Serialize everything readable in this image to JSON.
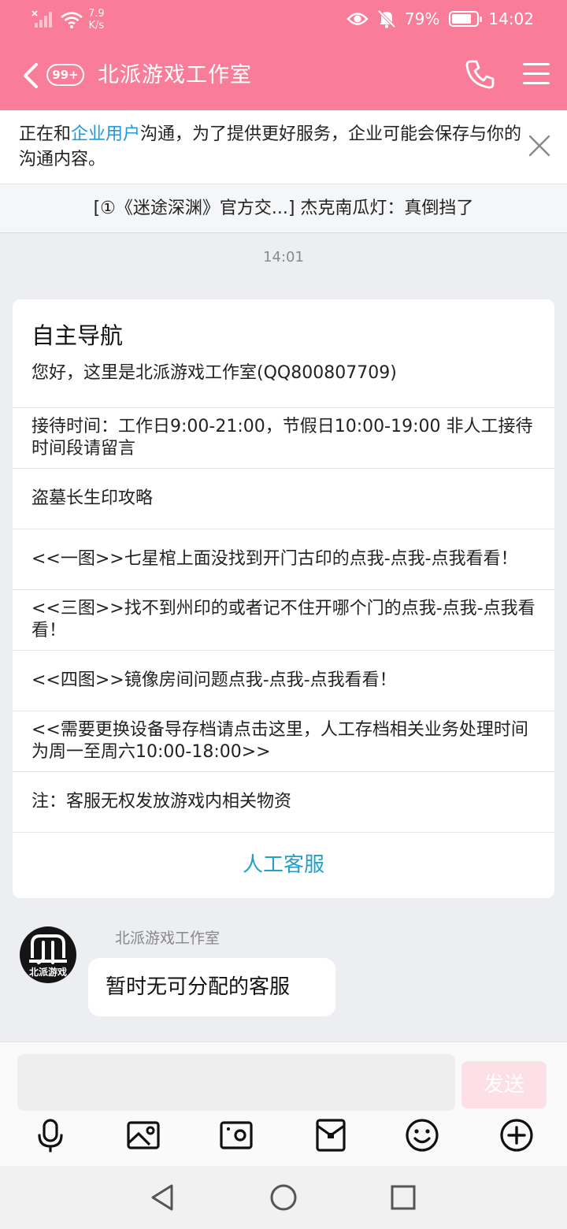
{
  "status_bar": {
    "net_speed_value": "7.9",
    "net_speed_unit": "K/s",
    "battery": "79%",
    "battery_level": 0.79,
    "time": "14:02",
    "icons": [
      "signal-icon",
      "wifi-icon",
      "eye-icon",
      "mute-bell-icon",
      "battery-icon"
    ]
  },
  "header": {
    "badge": "99+",
    "title": "北派游戏工作室",
    "icons": [
      "back-icon",
      "phone-icon",
      "menu-icon"
    ]
  },
  "notice": {
    "prefix": "正在和",
    "highlight": "企业用户",
    "suffix": "沟通，为了提供更好服务，企业可能会保存与你的沟通内容。",
    "highlight_color": "#1b9ae0"
  },
  "pinned_message": "[①《迷途深渊》官方交...] 杰克南瓜灯：真倒挡了",
  "messages": {
    "timestamp": "14:01",
    "nav_card": {
      "title": "自主导航",
      "greeting": "您好，这里是北派游戏工作室(QQ800807709)",
      "items": [
        "接待时间：工作日9:00-21:00，节假日10:00-19:00 非人工接待时间段请留言",
        "盗墓长生印攻略",
        "<<一图>>七星棺上面没找到开门古印的点我-点我-点我看看！",
        "<<三图>>找不到州印的或者记不住开哪个门的点我-点我-点我看看！",
        "<<四图>>镜像房间问题点我-点我-点我看看！",
        "<<需要更换设备导存档请点击这里，人工存档相关业务处理时间为周一至周六10:00-18:00>>",
        "注：客服无权发放游戏内相关物资"
      ],
      "human_service": "人工客服"
    },
    "sender_name": "北派游戏工作室",
    "avatar_text": "北派游戏",
    "bubble_text": "暂时无可分配的客服"
  },
  "input": {
    "placeholder": "",
    "send_label": "发送",
    "tools": [
      "microphone-icon",
      "image-icon",
      "camera-icon",
      "red-packet-icon",
      "emoji-icon",
      "plus-icon"
    ]
  },
  "system_nav": [
    "back-triangle-icon",
    "home-circle-icon",
    "recents-square-icon"
  ],
  "colors": {
    "header_bg": "#f97d99",
    "link": "#1b9ae0",
    "human_service": "#21a0c9",
    "send_disabled": "#fde0e6"
  }
}
